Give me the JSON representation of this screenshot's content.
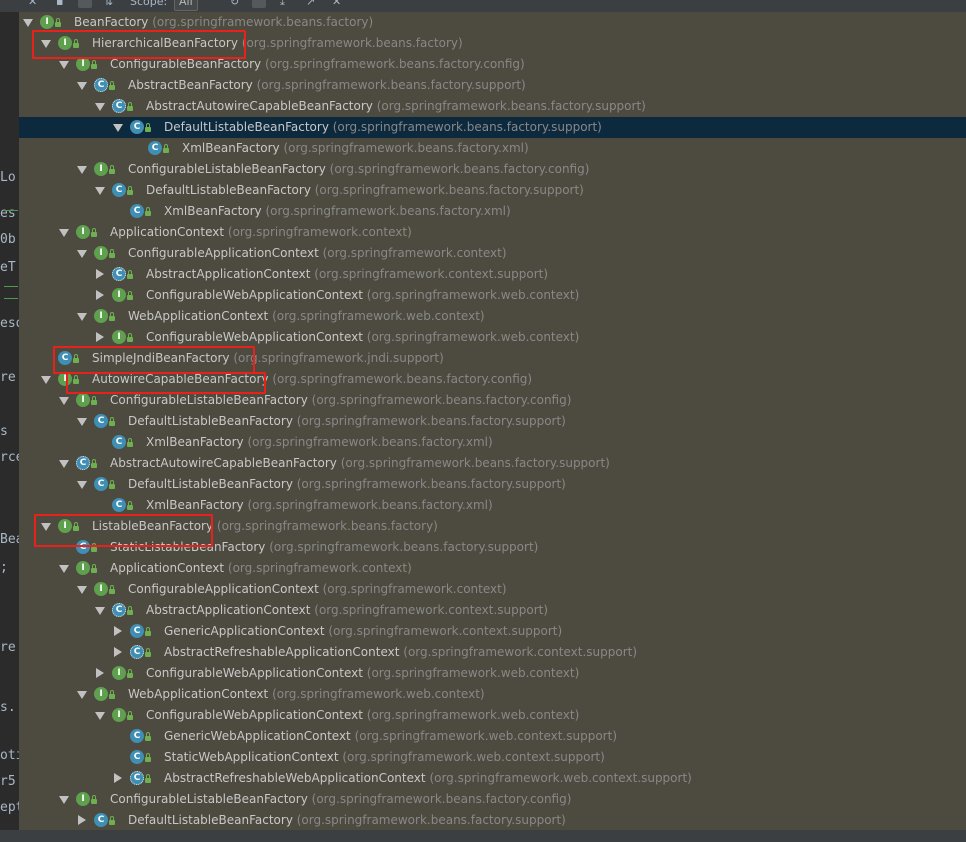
{
  "toolbar": {
    "scope_label": "Scope:",
    "scope_value": "All"
  },
  "editor": {
    "fragments": [
      "Lo",
      "es",
      "0b",
      "eT",
      "eso",
      "re",
      "s",
      "rce",
      "Bea",
      ";",
      "re",
      "s.",
      "oti",
      "r5",
      "ept"
    ]
  },
  "tree": {
    "rows": [
      {
        "name": "BeanFactory",
        "pkg": "(org.springframework.beans.factory)",
        "kind": "interface",
        "arrow": "down",
        "level": 0,
        "selected": false
      },
      {
        "name": "HierarchicalBeanFactory",
        "pkg": "(org.springframework.beans.factory)",
        "kind": "interface",
        "arrow": "down",
        "level": 1,
        "selected": false
      },
      {
        "name": "ConfigurableBeanFactory",
        "pkg": "(org.springframework.beans.factory.config)",
        "kind": "interface",
        "arrow": "down",
        "level": 2,
        "selected": false
      },
      {
        "name": "AbstractBeanFactory",
        "pkg": "(org.springframework.beans.factory.support)",
        "kind": "abstract",
        "arrow": "down",
        "level": 3,
        "selected": false
      },
      {
        "name": "AbstractAutowireCapableBeanFactory",
        "pkg": "(org.springframework.beans.factory.support)",
        "kind": "abstract",
        "arrow": "down",
        "level": 4,
        "selected": false
      },
      {
        "name": "DefaultListableBeanFactory",
        "pkg": "(org.springframework.beans.factory.support)",
        "kind": "class",
        "arrow": "down",
        "level": 5,
        "selected": true
      },
      {
        "name": "XmlBeanFactory",
        "pkg": "(org.springframework.beans.factory.xml)",
        "kind": "class",
        "arrow": "none",
        "level": 6,
        "selected": false
      },
      {
        "name": "ConfigurableListableBeanFactory",
        "pkg": "(org.springframework.beans.factory.config)",
        "kind": "interface",
        "arrow": "down",
        "level": 3,
        "selected": false
      },
      {
        "name": "DefaultListableBeanFactory",
        "pkg": "(org.springframework.beans.factory.support)",
        "kind": "class",
        "arrow": "down",
        "level": 4,
        "selected": false
      },
      {
        "name": "XmlBeanFactory",
        "pkg": "(org.springframework.beans.factory.xml)",
        "kind": "class",
        "arrow": "none",
        "level": 5,
        "selected": false
      },
      {
        "name": "ApplicationContext",
        "pkg": "(org.springframework.context)",
        "kind": "interface",
        "arrow": "down",
        "level": 2,
        "selected": false
      },
      {
        "name": "ConfigurableApplicationContext",
        "pkg": "(org.springframework.context)",
        "kind": "interface",
        "arrow": "down",
        "level": 3,
        "selected": false
      },
      {
        "name": "AbstractApplicationContext",
        "pkg": "(org.springframework.context.support)",
        "kind": "abstract",
        "arrow": "right",
        "level": 4,
        "selected": false
      },
      {
        "name": "ConfigurableWebApplicationContext",
        "pkg": "(org.springframework.web.context)",
        "kind": "interface",
        "arrow": "right",
        "level": 4,
        "selected": false
      },
      {
        "name": "WebApplicationContext",
        "pkg": "(org.springframework.web.context)",
        "kind": "interface",
        "arrow": "down",
        "level": 3,
        "selected": false
      },
      {
        "name": "ConfigurableWebApplicationContext",
        "pkg": "(org.springframework.web.context)",
        "kind": "interface",
        "arrow": "right",
        "level": 4,
        "selected": false
      },
      {
        "name": "SimpleJndiBeanFactory",
        "pkg": "(org.springframework.jndi.support)",
        "kind": "class",
        "arrow": "none",
        "level": 1,
        "selected": false
      },
      {
        "name": "AutowireCapableBeanFactory",
        "pkg": "(org.springframework.beans.factory.config)",
        "kind": "interface",
        "arrow": "down",
        "level": 1,
        "selected": false
      },
      {
        "name": "ConfigurableListableBeanFactory",
        "pkg": "(org.springframework.beans.factory.config)",
        "kind": "interface",
        "arrow": "down",
        "level": 2,
        "selected": false
      },
      {
        "name": "DefaultListableBeanFactory",
        "pkg": "(org.springframework.beans.factory.support)",
        "kind": "class",
        "arrow": "down",
        "level": 3,
        "selected": false
      },
      {
        "name": "XmlBeanFactory",
        "pkg": "(org.springframework.beans.factory.xml)",
        "kind": "class",
        "arrow": "none",
        "level": 4,
        "selected": false
      },
      {
        "name": "AbstractAutowireCapableBeanFactory",
        "pkg": "(org.springframework.beans.factory.support)",
        "kind": "abstract",
        "arrow": "down",
        "level": 2,
        "selected": false
      },
      {
        "name": "DefaultListableBeanFactory",
        "pkg": "(org.springframework.beans.factory.support)",
        "kind": "class",
        "arrow": "down",
        "level": 3,
        "selected": false
      },
      {
        "name": "XmlBeanFactory",
        "pkg": "(org.springframework.beans.factory.xml)",
        "kind": "class",
        "arrow": "none",
        "level": 4,
        "selected": false
      },
      {
        "name": "ListableBeanFactory",
        "pkg": "(org.springframework.beans.factory)",
        "kind": "interface",
        "arrow": "down",
        "level": 1,
        "selected": false
      },
      {
        "name": "StaticListableBeanFactory",
        "pkg": "(org.springframework.beans.factory.support)",
        "kind": "class",
        "arrow": "none",
        "level": 2,
        "selected": false
      },
      {
        "name": "ApplicationContext",
        "pkg": "(org.springframework.context)",
        "kind": "interface",
        "arrow": "down",
        "level": 2,
        "selected": false
      },
      {
        "name": "ConfigurableApplicationContext",
        "pkg": "(org.springframework.context)",
        "kind": "interface",
        "arrow": "down",
        "level": 3,
        "selected": false
      },
      {
        "name": "AbstractApplicationContext",
        "pkg": "(org.springframework.context.support)",
        "kind": "abstract",
        "arrow": "down",
        "level": 4,
        "selected": false
      },
      {
        "name": "GenericApplicationContext",
        "pkg": "(org.springframework.context.support)",
        "kind": "class",
        "arrow": "right",
        "level": 5,
        "selected": false
      },
      {
        "name": "AbstractRefreshableApplicationContext",
        "pkg": "(org.springframework.context.support)",
        "kind": "abstract",
        "arrow": "right",
        "level": 5,
        "selected": false
      },
      {
        "name": "ConfigurableWebApplicationContext",
        "pkg": "(org.springframework.web.context)",
        "kind": "interface",
        "arrow": "right",
        "level": 4,
        "selected": false
      },
      {
        "name": "WebApplicationContext",
        "pkg": "(org.springframework.web.context)",
        "kind": "interface",
        "arrow": "down",
        "level": 3,
        "selected": false
      },
      {
        "name": "ConfigurableWebApplicationContext",
        "pkg": "(org.springframework.web.context)",
        "kind": "interface",
        "arrow": "down",
        "level": 4,
        "selected": false
      },
      {
        "name": "GenericWebApplicationContext",
        "pkg": "(org.springframework.web.context.support)",
        "kind": "class",
        "arrow": "none",
        "level": 5,
        "selected": false
      },
      {
        "name": "StaticWebApplicationContext",
        "pkg": "(org.springframework.web.context.support)",
        "kind": "class",
        "arrow": "none",
        "level": 5,
        "selected": false
      },
      {
        "name": "AbstractRefreshableWebApplicationContext",
        "pkg": "(org.springframework.web.context.support)",
        "kind": "abstract",
        "arrow": "right",
        "level": 5,
        "selected": false
      },
      {
        "name": "ConfigurableListableBeanFactory",
        "pkg": "(org.springframework.beans.factory.config)",
        "kind": "interface",
        "arrow": "down",
        "level": 2,
        "selected": false
      },
      {
        "name": "DefaultListableBeanFactory",
        "pkg": "(org.springframework.beans.factory.support)",
        "kind": "class",
        "arrow": "right",
        "level": 3,
        "selected": false
      }
    ]
  },
  "colors": {
    "panel_background": "#4d4a3f",
    "selected_row": "#0d293e",
    "interface_icon": "#5fa04e",
    "class_icon": "#3f8fb5",
    "highlight_box": "#e8221b"
  }
}
